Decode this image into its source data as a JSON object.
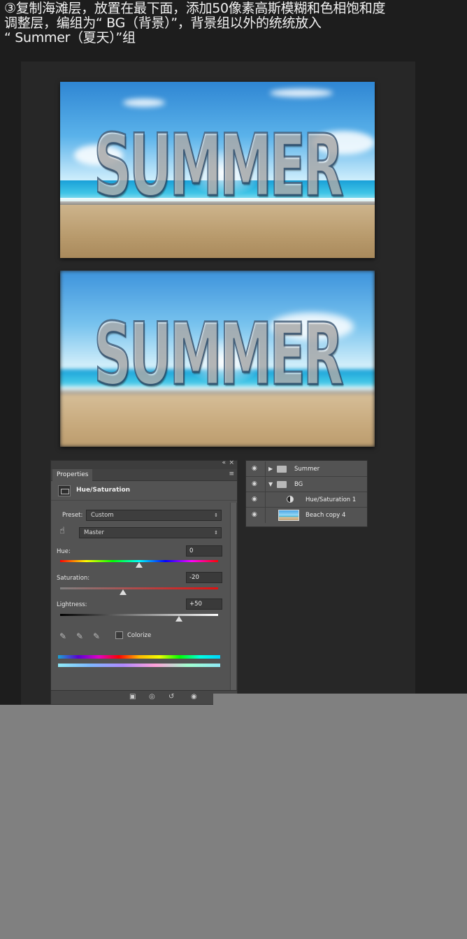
{
  "caption": {
    "line1": "③复制海滩层，放置在最下面，添加50像素高斯模糊和色相饱和度",
    "line2": "调整层，编组为“ BG（背景）”，背景组以外的统统放入",
    "line3": "“ Summer（夏天）”组"
  },
  "preview": {
    "word": "SUMMER"
  },
  "properties_panel": {
    "collapse_icon": "«",
    "close_icon": "×",
    "tab_label": "Properties",
    "menu_icon": "≡",
    "adjustment_title": "Hue/Saturation",
    "preset_label": "Preset:",
    "preset_value": "Custom",
    "channel_value": "Master",
    "hue_label": "Hue:",
    "hue_value": "0",
    "saturation_label": "Saturation:",
    "saturation_value": "-20",
    "lightness_label": "Lightness:",
    "lightness_value": "+50",
    "colorize_label": "Colorize",
    "sliders": {
      "hue_position": 0.5,
      "saturation_position": 0.4,
      "lightness_position": 0.75
    }
  },
  "layers_panel": {
    "layers": [
      {
        "name": "Summer"
      },
      {
        "name": "BG"
      },
      {
        "name": "Hue/Saturation 1"
      },
      {
        "name": "Beach copy 4"
      }
    ]
  },
  "colors": {
    "background": "#1d1d1d",
    "panel": "#535353",
    "lower_block": "#808080"
  }
}
